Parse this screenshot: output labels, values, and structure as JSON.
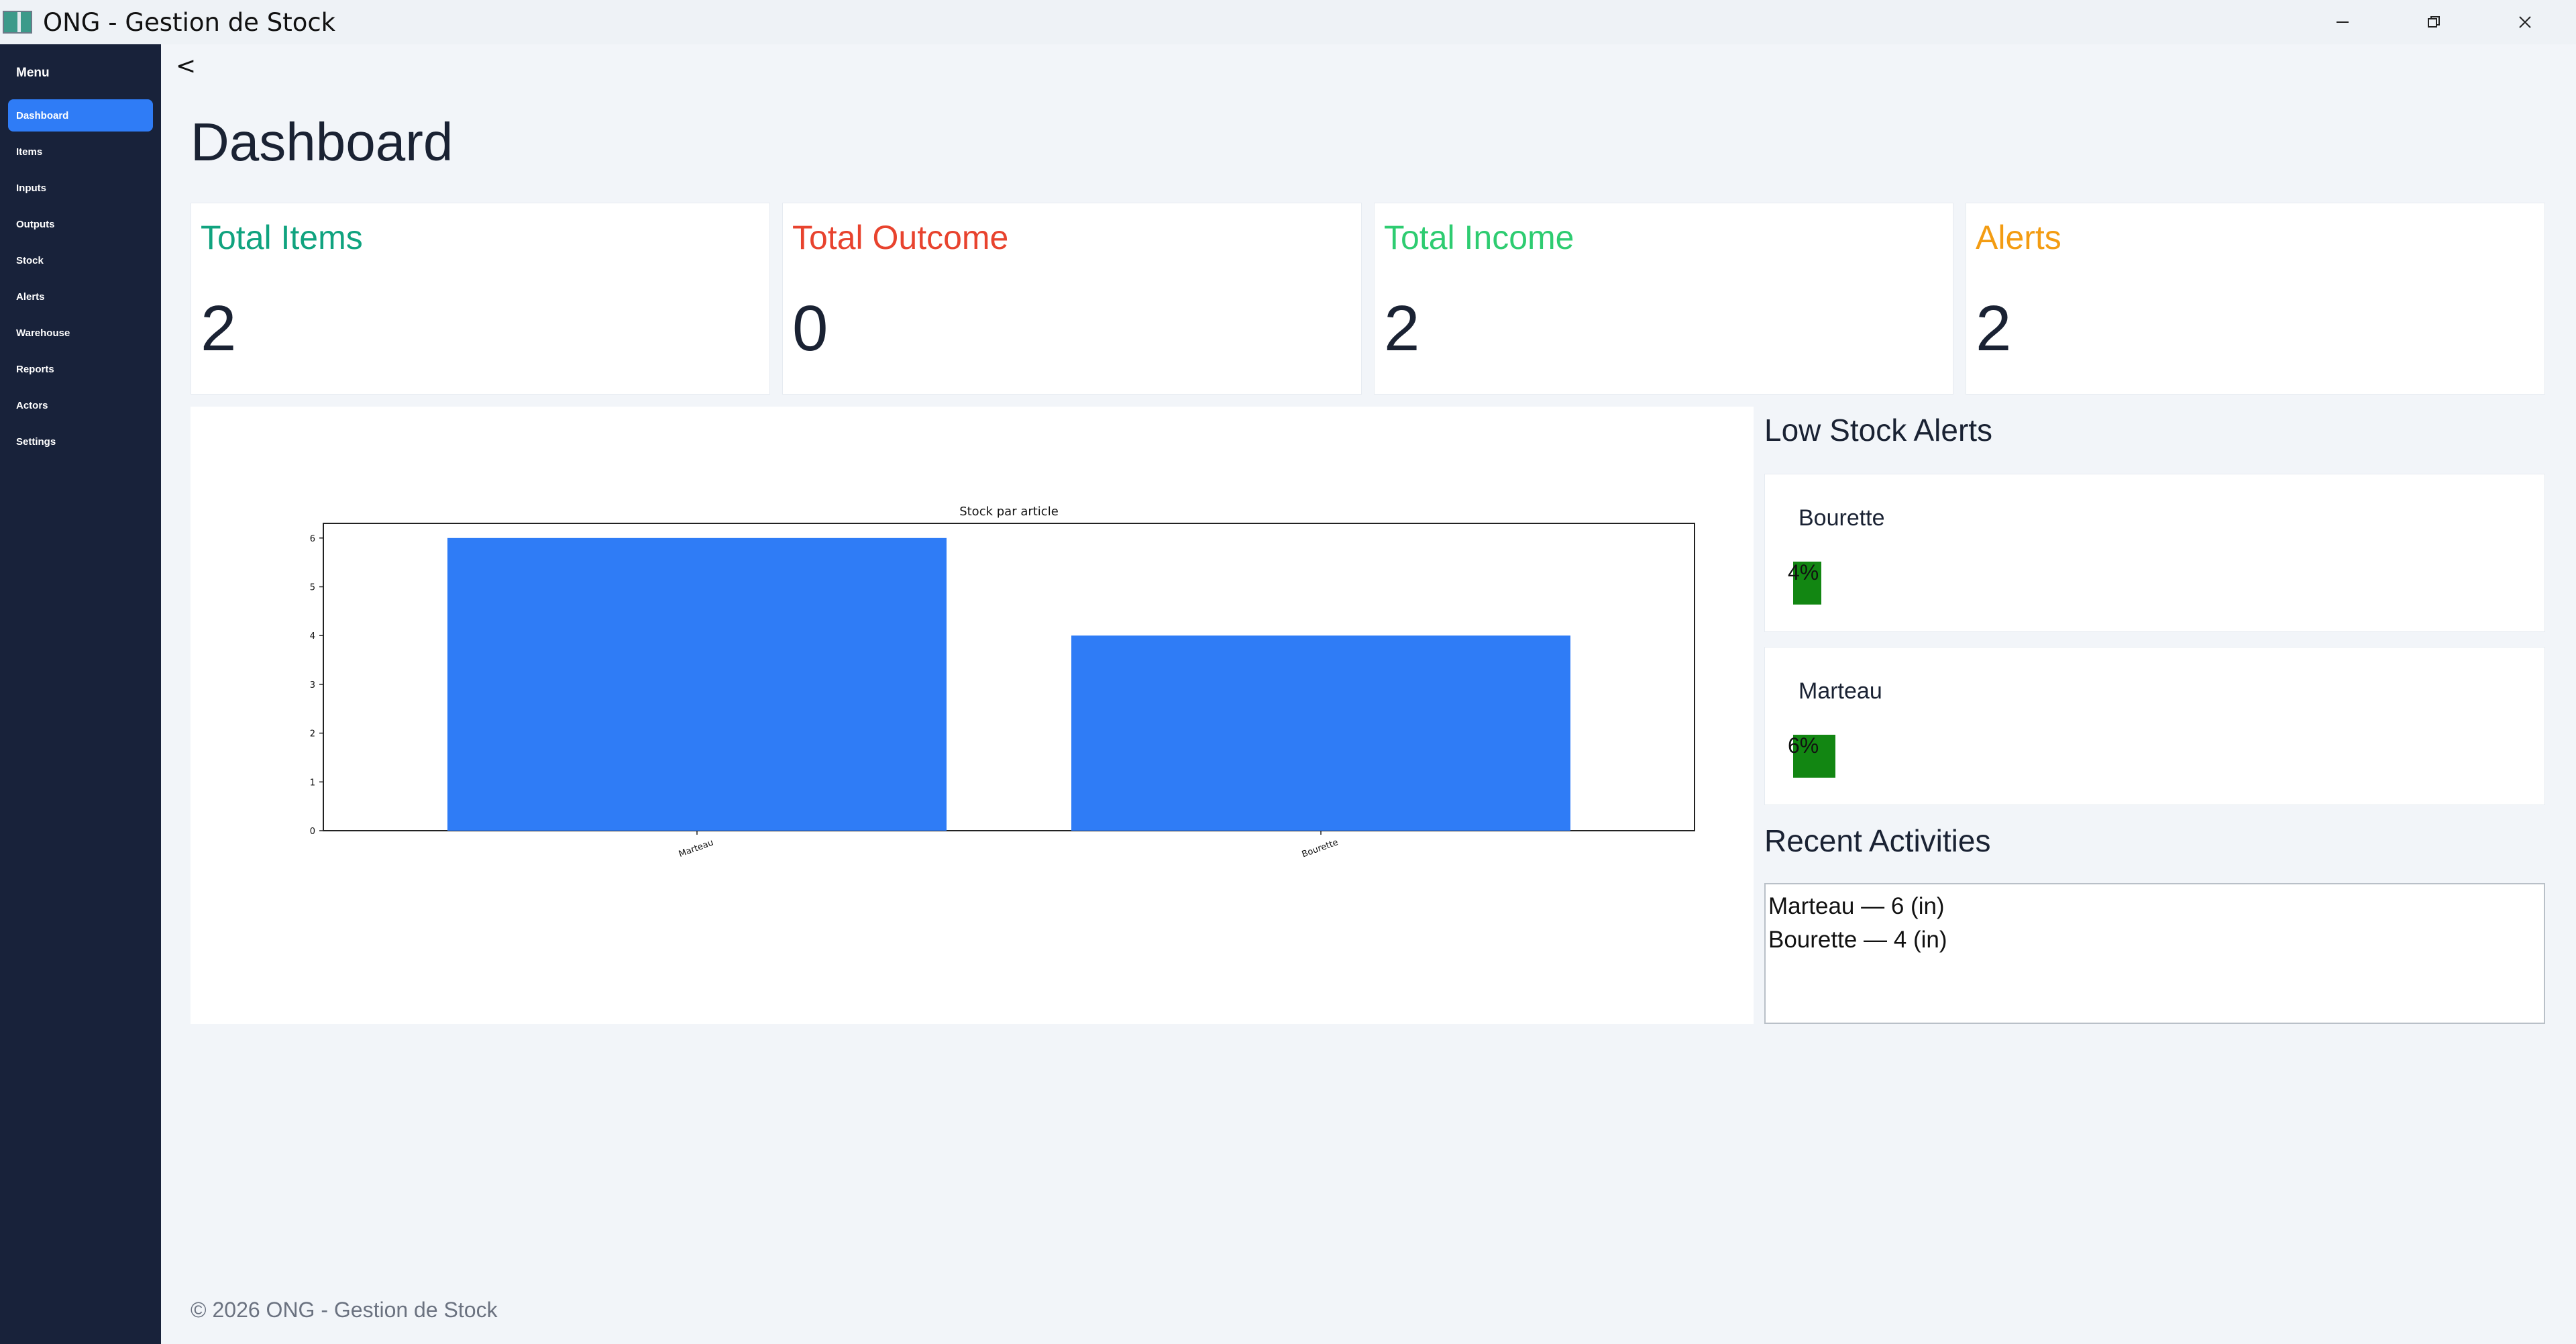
{
  "window": {
    "title": "ONG - Gestion de Stock",
    "controls": [
      "minimize-icon",
      "restore-icon",
      "close-icon"
    ]
  },
  "sidebar": {
    "title": "Menu",
    "items": [
      {
        "label": "Dashboard",
        "active": true
      },
      {
        "label": "Items"
      },
      {
        "label": "Inputs"
      },
      {
        "label": "Outputs"
      },
      {
        "label": "Stock"
      },
      {
        "label": "Alerts"
      },
      {
        "label": "Warehouse"
      },
      {
        "label": "Reports"
      },
      {
        "label": "Actors"
      },
      {
        "label": "Settings"
      }
    ]
  },
  "collapse_label": "<",
  "page_title": "Dashboard",
  "cards": [
    {
      "label": "Total Items",
      "value": "2",
      "color": "#10a37f"
    },
    {
      "label": "Total Outcome",
      "value": "0",
      "color": "#e8432e"
    },
    {
      "label": "Total Income",
      "value": "2",
      "color": "#2ecc71"
    },
    {
      "label": "Alerts",
      "value": "2",
      "color": "#f39c12"
    }
  ],
  "chart_data": {
    "type": "bar",
    "title": "Stock par article",
    "categories": [
      "Marteau",
      "Bourette"
    ],
    "values": [
      6,
      4
    ],
    "xlabel": "",
    "ylabel": "",
    "ylim": [
      0,
      6.3
    ],
    "yticks": [
      "0",
      "1",
      "2",
      "3",
      "4",
      "5",
      "6"
    ],
    "bar_color": "#2f7cf6",
    "grid": false
  },
  "low_stock": {
    "title": "Low Stock Alerts",
    "items": [
      {
        "name": "Bourette",
        "percent_label": "4%",
        "percent": 4
      },
      {
        "name": "Marteau",
        "percent_label": "6%",
        "percent": 6
      }
    ]
  },
  "recent": {
    "title": "Recent Activities",
    "lines": [
      "Marteau — 6 (in)",
      "Bourette — 4 (in)"
    ]
  },
  "footer": "© 2026 ONG - Gestion de Stock"
}
